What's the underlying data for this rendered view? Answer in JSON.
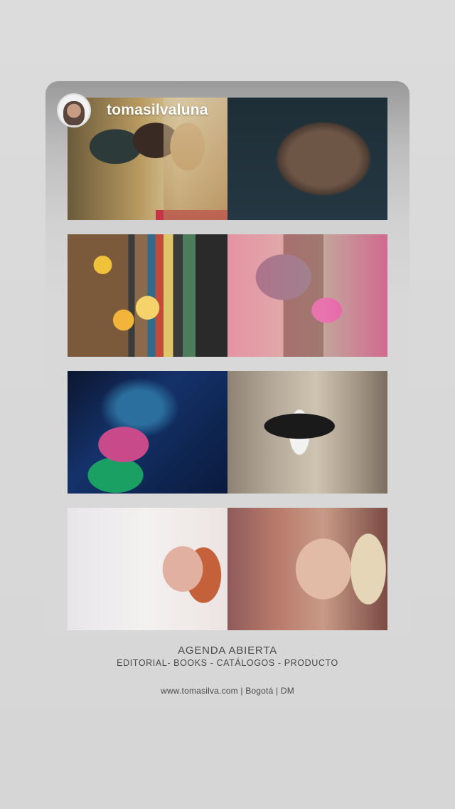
{
  "profile": {
    "username": "tomasilvaluna",
    "avatar_icon": "profile-avatar"
  },
  "gallery": {
    "photos": [
      {
        "name": "photo-woman-on-golden-chair"
      },
      {
        "name": "photo-shaggy-dog"
      },
      {
        "name": "photo-lemon-cocktail-still-life"
      },
      {
        "name": "photo-pink-hair-fur-coat"
      },
      {
        "name": "photo-stage-performer"
      },
      {
        "name": "photo-leather-jacket-pose"
      },
      {
        "name": "photo-redhead-portrait"
      },
      {
        "name": "photo-tattooed-blonde-portrait"
      }
    ]
  },
  "caption": {
    "headline": "AGENDA ABIERTA",
    "services": "EDITORIAL- BOOKS - CATÁLOGOS - PRODUCTO",
    "contact": "www.tomasilva.com | Bogotá | DM"
  },
  "colors": {
    "background": "#d8d8d8",
    "text": "#4a4a4a",
    "username": "#ffffff"
  }
}
